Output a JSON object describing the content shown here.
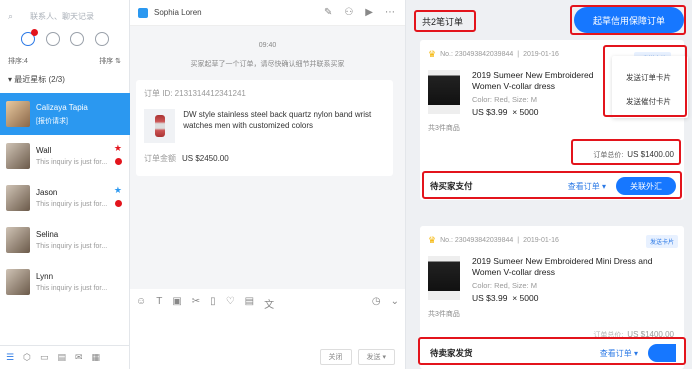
{
  "left": {
    "search_placeholder": "联系人、聊天记录",
    "sort_label": "排序:4",
    "sort_button": "排序 ⇅",
    "group_label": "▾ 最近星标 (2/3)",
    "contacts": [
      {
        "name": "Calizaya Tapia",
        "sub": "[报价请求]"
      },
      {
        "name": "Wall",
        "sub": "This inquiry is just for..."
      },
      {
        "name": "Jason",
        "sub": "This inquiry is just for..."
      },
      {
        "name": "Selina",
        "sub": "This inquiry is just for..."
      },
      {
        "name": "Lynn",
        "sub": "This inquiry is just for..."
      }
    ]
  },
  "chat": {
    "contact_name": "Sophia Loren",
    "time": "09:40",
    "notice": "买家起草了一个订单，请尽快确认细节并联系买家",
    "order_id": "订单 ID: 2131314412341241",
    "product_name": "DW style stainless steel back quartz nylon band wrist watches men with customized colors",
    "amount_label": "订单金额",
    "amount": "US $2450.00",
    "close_button": "关闭",
    "send_button": "发送 ▾"
  },
  "orders": {
    "count_title": "共2笔订单",
    "cta": "起草信用保障订单",
    "send_card": "▴ 发送卡片",
    "send_card_2": "发送卡片",
    "dropdown": [
      "发送订单卡片",
      "发送催付卡片"
    ],
    "items": [
      {
        "no": "No.: 230493842039844",
        "date": "2019-01-16",
        "name": "2019 Sumeer New Embroidered Women V-collar dress",
        "meta": "Color: Red,  Size: M",
        "price": "US $3.99",
        "qty": "× 5000",
        "count": "共3件商品",
        "total_label": "订单总价:",
        "total": "US $1400.00",
        "status": "待买家支付",
        "view": "查看订单 ▾",
        "action": "关联外汇"
      },
      {
        "no": "No.: 230493842039844",
        "date": "2019-01-16",
        "name": "2019 Sumeer New Embroidered Mini Dress and Women V-collar dress",
        "meta": "Color: Red,  Size: M",
        "price": "US $3.99",
        "qty": "× 5000",
        "count": "共3件商品",
        "total_label": "订单总价:",
        "total": "US $1400.00",
        "status": "待卖家发货",
        "view": "查看订单 ▾"
      }
    ]
  }
}
